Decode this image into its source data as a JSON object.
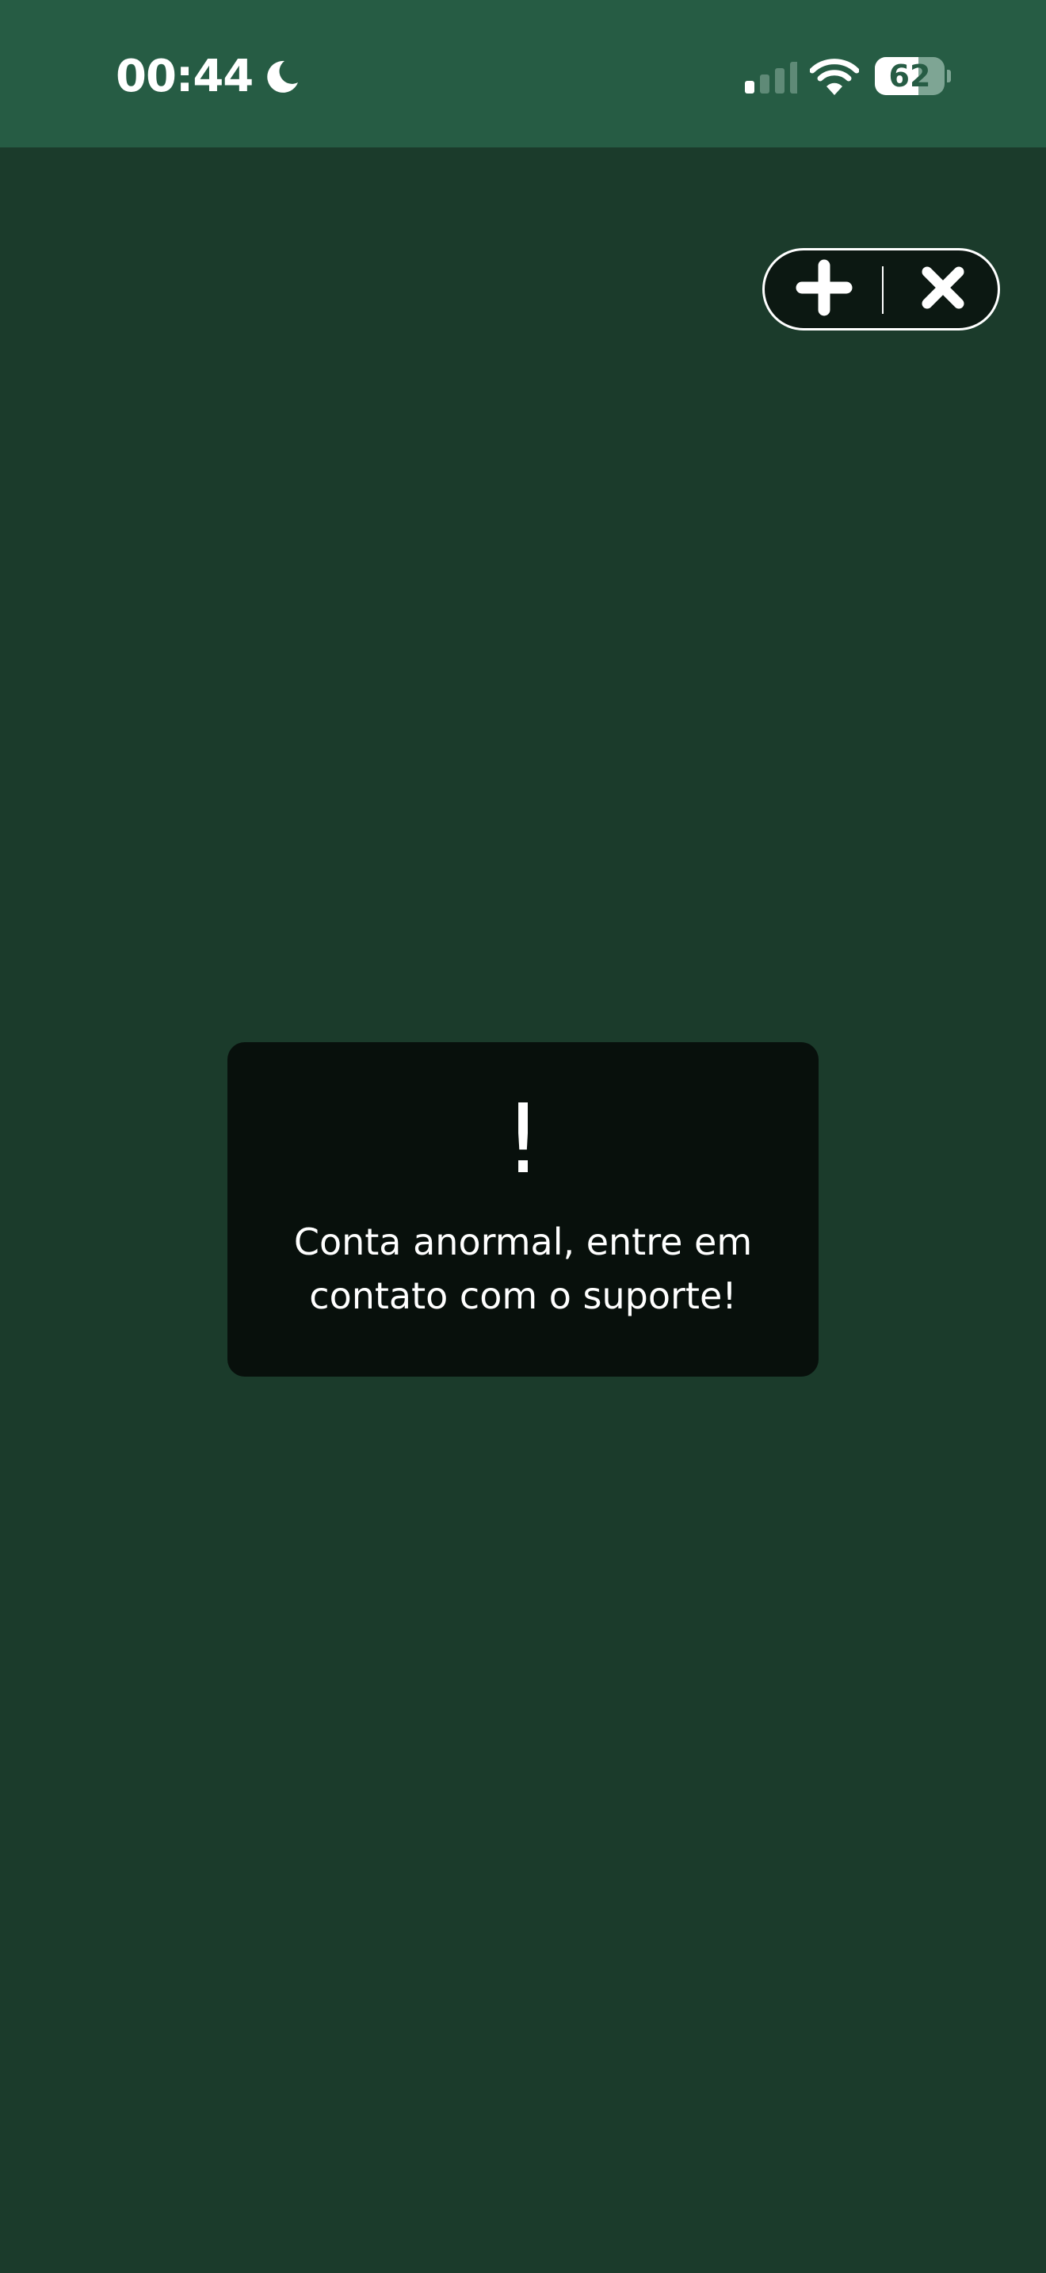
{
  "status_bar": {
    "time": "00:44",
    "battery_level": "62",
    "battery_fraction": 0.62,
    "signal_bars_active": 1,
    "signal_bars_total": 4,
    "icons": [
      "moon-icon",
      "cellular-signal-icon",
      "wifi-icon",
      "battery-icon"
    ]
  },
  "capsule": {
    "icons": [
      "plus-icon",
      "close-icon"
    ]
  },
  "toast": {
    "mark": "!",
    "message": "Conta anormal, entre em contato com o suporte!"
  },
  "colors": {
    "background": "#1b3b2b",
    "status_bar": "#265c44",
    "toast": "#08100c",
    "capsule": "#0c1812",
    "text": "#ffffff"
  }
}
